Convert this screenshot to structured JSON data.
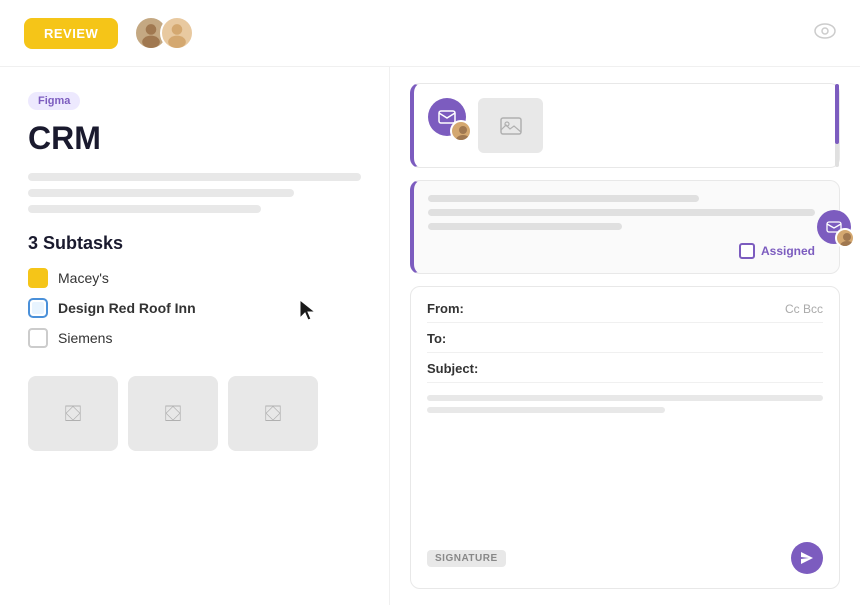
{
  "topbar": {
    "review_label": "REVIEW",
    "eye_label": "visibility"
  },
  "left": {
    "badge": "Figma",
    "title": "CRM",
    "subtasks_heading": "3 Subtasks",
    "subtasks": [
      {
        "id": "maceys",
        "label": "Macey's",
        "icon_type": "yellow"
      },
      {
        "id": "design-red-roof",
        "label": "Design Red Roof Inn",
        "icon_type": "blue-rounded",
        "active": true
      },
      {
        "id": "siemens",
        "label": "Siemens",
        "icon_type": "gray"
      }
    ],
    "images": [
      "image1",
      "image2",
      "image3"
    ]
  },
  "right": {
    "card1": {
      "has_envelope": true,
      "has_image": true
    },
    "card2": {
      "assigned_label": "Assigned",
      "has_avatar": true
    },
    "compose": {
      "from_label": "From:",
      "to_label": "To:",
      "subject_label": "Subject:",
      "cc_bcc_label": "Cc Bcc",
      "signature_label": "SIGNATURE"
    }
  },
  "colors": {
    "purple": "#7c5cbf",
    "yellow": "#f5c518",
    "blue": "#4a90d9"
  }
}
